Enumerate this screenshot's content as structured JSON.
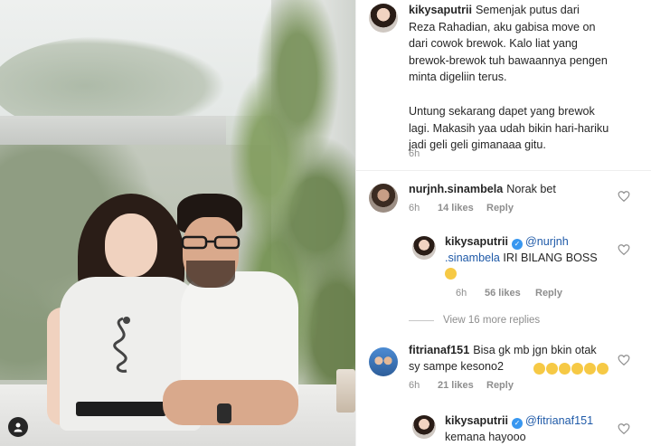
{
  "caption": {
    "username": "kikysaputrii",
    "paragraph1": "Semenjak putus dari\nReza Rahadian, aku gabisa move on\ndari cowok brewok. Kalo liat yang\nbrewok-brewok tuh bawaannya pengen\nminta digeliin terus.",
    "paragraph2": "Untung sekarang dapet yang brewok\nlagi. Makasih yaa udah bikin hari-hariku\njadi geli geli gimanaaa gitu.",
    "time": "6h"
  },
  "comments": [
    {
      "username": "nurjnh.sinambela",
      "text": "Norak bet",
      "time": "6h",
      "likes": "14 likes",
      "reply": "Reply"
    },
    {
      "username": "kikysaputrii",
      "mention": "@nurjnh\n.sinambela",
      "text": "IRI BILANG BOSS",
      "time": "6h",
      "likes": "56 likes",
      "reply": "Reply"
    },
    {
      "username": "fitrianaf151",
      "text": "Bisa gk mb jgn bkin otak\nsy sampe kesono2",
      "time": "6h",
      "likes": "21 likes",
      "reply": "Reply"
    },
    {
      "username": "kikysaputrii",
      "mention": "@fitrianaf151",
      "text": "kemana hayooo"
    }
  ],
  "view_replies": "View 16 more replies",
  "colors": {
    "mention": "#1f5aa8",
    "meta": "#8e8e8e",
    "verified": "#3897f0"
  },
  "icons": [
    "heart-icon",
    "verified-icon",
    "profile-icon",
    "emoji-icon"
  ]
}
